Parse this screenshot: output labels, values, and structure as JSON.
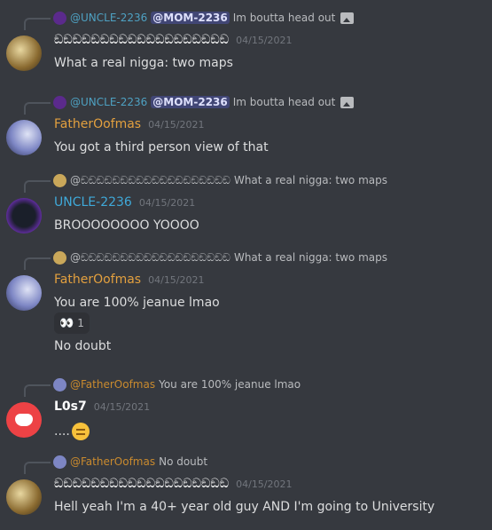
{
  "messages": [
    {
      "reply": {
        "author": "@UNCLE-2236",
        "mention": "@MOM-2236",
        "text": "Im boutta head out",
        "attachment_icon": "image-icon"
      },
      "author": "ඞඞඞඞඞඞඞඞඞඞඞඞඞඞඞඞඞඞඞ",
      "timestamp": "04/15/2021",
      "content": "What a real nigga: two maps"
    },
    {
      "reply": {
        "author": "@UNCLE-2236",
        "mention": "@MOM-2236",
        "text": "Im boutta head out",
        "attachment_icon": "image-icon"
      },
      "author": "FatherOofmas",
      "timestamp": "04/15/2021",
      "content": "You got a third person view of that"
    },
    {
      "reply": {
        "author": "@ඞඞඞඞඞඞඞඞඞඞඞඞඞඞඞඞඞඞඞ",
        "text": "What a real nigga: two maps"
      },
      "author": "UNCLE-2236",
      "timestamp": "04/15/2021",
      "content": "BROOOOOOOO YOOOO"
    },
    {
      "reply": {
        "author": "@ඞඞඞඞඞඞඞඞඞඞඞඞඞඞඞඞඞඞඞ",
        "text": "What a real nigga: two maps"
      },
      "author": "FatherOofmas",
      "timestamp": "04/15/2021",
      "content": "You are 100% jeanue lmao",
      "reaction": {
        "emoji": "👀",
        "count": "1"
      },
      "followup": "No doubt"
    },
    {
      "reply": {
        "author": "@FatherOofmas",
        "text": "You are 100% jeanue lmao"
      },
      "author": "L0s7",
      "timestamp": "04/15/2021",
      "content": "....",
      "content_emoji": "expressionless-face"
    },
    {
      "reply": {
        "author": "@FatherOofmas",
        "text": "No doubt"
      },
      "author": "ඞඞඞඞඞඞඞඞඞඞඞඞඞඞඞඞඞඞඞ",
      "timestamp": "04/15/2021",
      "content": "Hell yeah I'm a 40+ year old guy AND I'm going to University"
    }
  ],
  "colors": {
    "background": "#36393f",
    "father": "#e3a03f",
    "uncle": "#3fa9d9",
    "text": "#dcddde",
    "timestamp": "#72767d"
  }
}
